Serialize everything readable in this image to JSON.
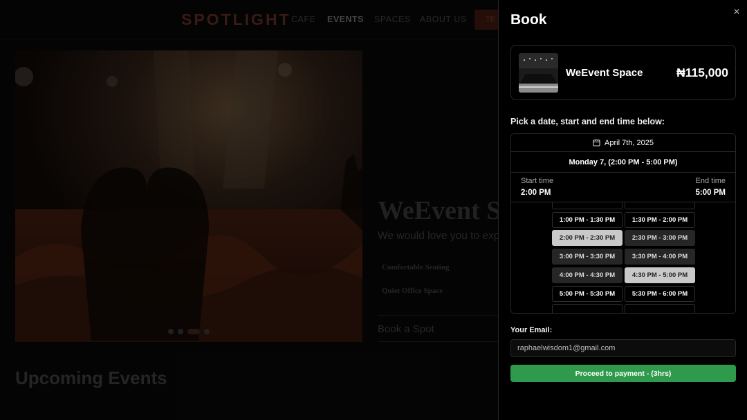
{
  "site": {
    "logo": "SPOTLIGHT",
    "nav": [
      "CAFE",
      "EVENTS",
      "SPACES",
      "ABOUT US"
    ],
    "nav_active": "EVENTS",
    "cta_label": "TE",
    "carousel": {
      "dot_count": 4,
      "active_index": 2
    },
    "venue_title": "WeEvent Sp",
    "venue_subtitle": "We would love you to expe",
    "features": [
      "Comfortable Seating",
      "Quiet Office Space"
    ],
    "book_spot_label": "Book a Spot",
    "upcoming_heading": "Upcoming Events"
  },
  "drawer": {
    "title": "Book",
    "close_icon": "close-icon",
    "product": {
      "name": "WeEvent Space",
      "price": "₦115,000"
    },
    "pick_label": "Pick a date, start and end time below:",
    "date_label": "April 7th, 2025",
    "day_summary": "Monday 7, (2:00 PM - 5:00 PM)",
    "start_label": "Start time",
    "start_value": "2:00 PM",
    "end_label": "End time",
    "end_value": "5:00 PM",
    "slots": [
      {
        "label": "",
        "state": "default"
      },
      {
        "label": "",
        "state": "default"
      },
      {
        "label": "1:00 PM - 1:30 PM",
        "state": "default"
      },
      {
        "label": "1:30 PM - 2:00 PM",
        "state": "default"
      },
      {
        "label": "2:00 PM - 2:30 PM",
        "state": "selected"
      },
      {
        "label": "2:30 PM - 3:00 PM",
        "state": "range"
      },
      {
        "label": "3:00 PM - 3:30 PM",
        "state": "range"
      },
      {
        "label": "3:30 PM - 4:00 PM",
        "state": "range"
      },
      {
        "label": "4:00 PM - 4:30 PM",
        "state": "range"
      },
      {
        "label": "4:30 PM - 5:00 PM",
        "state": "selected"
      },
      {
        "label": "5:00 PM - 5:30 PM",
        "state": "default"
      },
      {
        "label": "5:30 PM - 6:00 PM",
        "state": "default"
      },
      {
        "label": "",
        "state": "default"
      },
      {
        "label": "",
        "state": "default"
      }
    ],
    "email_label": "Your Email:",
    "email_value": "raphaelwisdom1@gmail.com",
    "pay_label": "Proceed to payment - (3hrs)",
    "colors": {
      "accent_green": "#2f9a4b",
      "selected_slot": "#c9c9c9",
      "range_slot": "#262626"
    }
  }
}
